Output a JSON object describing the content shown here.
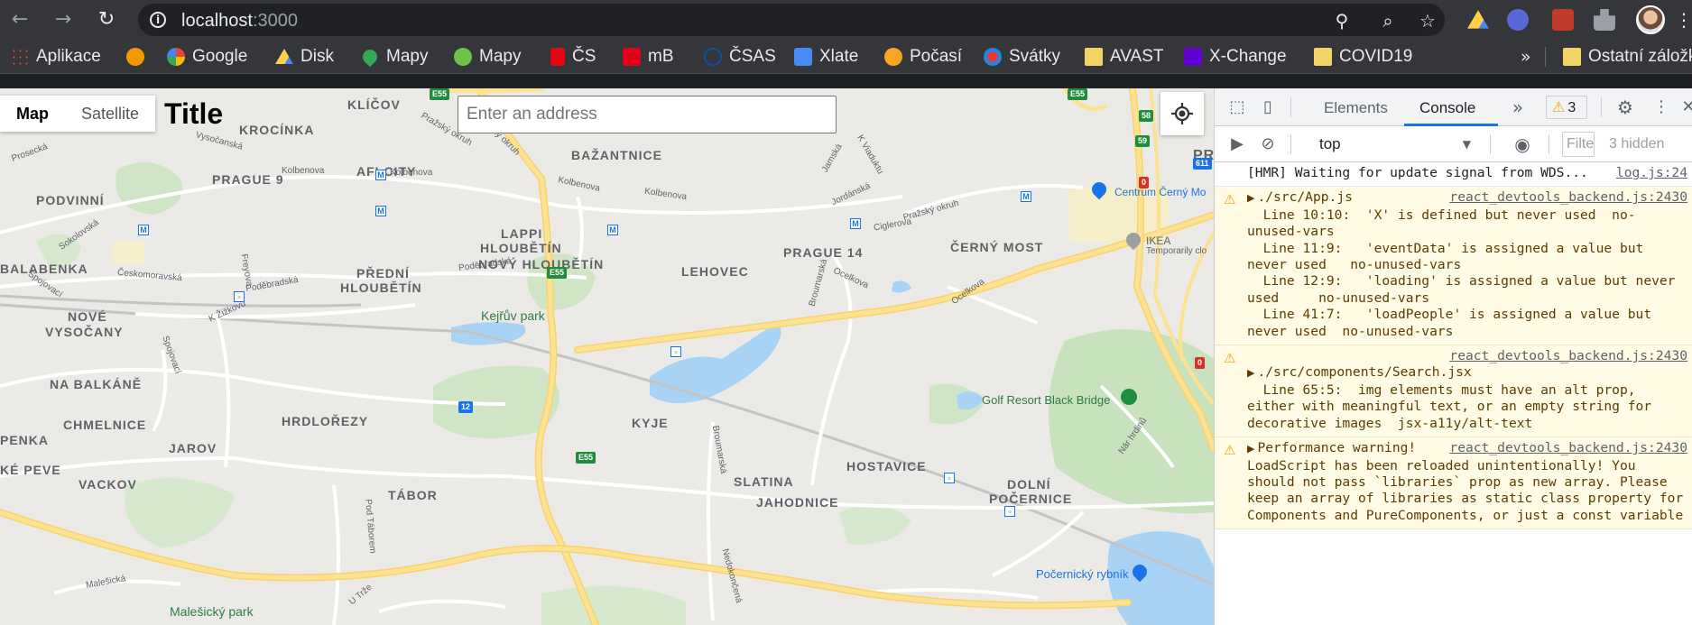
{
  "browser": {
    "url_host": "localhost",
    "url_port": ":3000",
    "bookmarks": [
      {
        "label": "Aplikace",
        "color": "#4285f4"
      },
      {
        "label": "",
        "color": "#f29900"
      },
      {
        "label": "Google",
        "color": "#ffffff"
      },
      {
        "label": "Disk",
        "color": "#1fa463"
      },
      {
        "label": "Mapy",
        "color": "#34a853"
      },
      {
        "label": "Mapy",
        "color": "#6cc24a"
      },
      {
        "label": "ČS",
        "color": "#e30613"
      },
      {
        "label": "mB",
        "color": "#e2001a"
      },
      {
        "label": "ČSAS",
        "color": "#0b4fa3"
      },
      {
        "label": "Xlate",
        "color": "#4a8af4"
      },
      {
        "label": "Počasí",
        "color": "#f5a623"
      },
      {
        "label": "Svátky",
        "color": "#1e88e5"
      },
      {
        "label": "AVAST",
        "color": "#f2d365"
      },
      {
        "label": "X-Change",
        "color": "#6001d2"
      },
      {
        "label": "COVID19",
        "color": "#f2d365"
      }
    ],
    "other_bookmarks": "Ostatní záložk"
  },
  "page": {
    "map_type": {
      "map": "Map",
      "satellite": "Satellite"
    },
    "title": "Title",
    "address_placeholder": "Enter an address"
  },
  "map": {
    "districts": [
      "KLÍČOV",
      "KROCÍNKA",
      "BAŽANTNICE",
      "AFI CITY",
      "PRAGUE 9",
      "PODVINNÍ",
      "LAPPI",
      "HLOUBĚTÍN",
      "NOVÝ HLOUBĚTÍN",
      "LEHOVEC",
      "PRAGUE 14",
      "ČERNÝ MOST",
      "BALABENKA",
      "PŘEDNÍ",
      "HLOUBĚTÍN",
      "NOVÉ",
      "VYSOČANY",
      "NA BALKÁNĚ",
      "CHMELNICE",
      "HRDLOŘEZY",
      "KYJE",
      "JAROV",
      "PENKA",
      "VACKOV",
      "HOSTAVICE",
      "SLATINA",
      "JAHODNICE",
      "DOLNÍ",
      "POČERNICE",
      "TÁBOR",
      "KÉ PEVE",
      "PR"
    ],
    "streets": [
      "Prosecká",
      "Vysočanská",
      "Kolbenova",
      "Kolbenova",
      "Kolbenova",
      "Kolbenova",
      "Jordánská",
      "Jamská",
      "K Viaduktu",
      "Pražský okruh",
      "Pražský okruh",
      "Pražský okruh",
      "Ciglerova",
      "Sokolovská",
      "Poděbradská",
      "Poděbradská",
      "Českomoravská",
      "Spojovací",
      "Freyova",
      "K Žižkovu",
      "Spojovací",
      "Broumarská",
      "Ocelkova",
      "Ocelkova",
      "Broumarská",
      "Nár hrdinů",
      "Nedokončená",
      "Pod Táborem",
      "U Trže",
      "Malešická"
    ],
    "parks": [
      "Kejřův park",
      "Malešický park"
    ],
    "pois": [
      "Centrum Černý Mo",
      "IKEA",
      "Temporarily clo",
      "Golf Resort Black Bridge",
      "Počernický rybník"
    ],
    "shields": [
      "E55",
      "E55",
      "E55",
      "E55",
      "12",
      "12",
      "58",
      "59",
      "611",
      "0",
      "0"
    ]
  },
  "devtools": {
    "tabs": [
      "Elements",
      "Console"
    ],
    "warning_count": "3",
    "context": "top",
    "filter_placeholder": "Filte",
    "hidden": "3 hidden",
    "messages": [
      {
        "level": "log",
        "text": "[HMR] Waiting for update signal from WDS...",
        "source": "log.js:24"
      },
      {
        "level": "warn",
        "text": "./src/App.js\n  Line 10:10:  'X' is defined but never used  no-unused-vars\n  Line 11:9:   'eventData' is assigned a value but never used   no-unused-vars\n  Line 12:9:   'loading' is assigned a value but never used     no-unused-vars\n  Line 41:7:   'loadPeople' is assigned a value but never used  no-unused-vars",
        "source": "react_devtools_backend.js:2430"
      },
      {
        "level": "warn",
        "text": "./src/components/Search.jsx\n  Line 65:5:  img elements must have an alt prop, either with meaningful text, or an empty string for decorative images  jsx-a11y/alt-text",
        "source": "react_devtools_backend.js:2430"
      },
      {
        "level": "warn",
        "text": "Performance warning! LoadScript has been reloaded unintentionally! You should not pass `libraries` prop as new array. Please keep an array of libraries as static class property for Components and PureComponents, or just a const variable",
        "source": "react_devtools_backend.js:2430"
      }
    ]
  }
}
